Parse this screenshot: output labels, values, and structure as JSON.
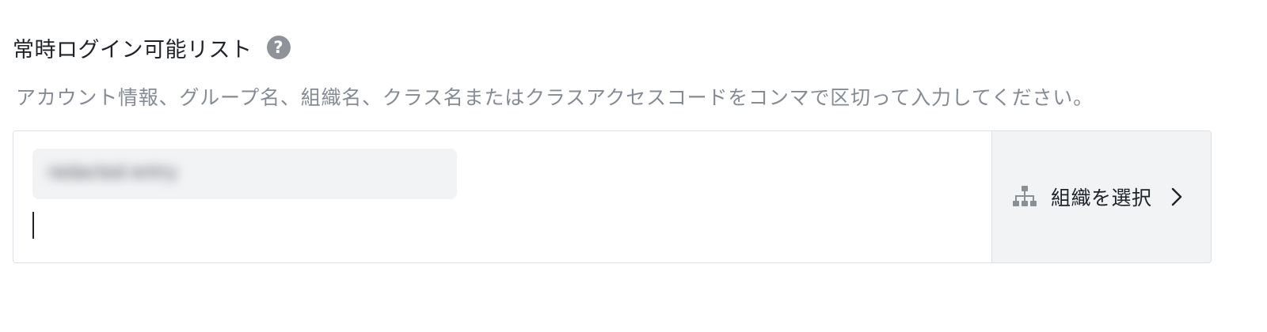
{
  "section": {
    "title": "常時ログイン可能リスト",
    "help_glyph": "?",
    "description": "アカウント情報、グループ名、組織名、クラス名またはクラスアクセスコードをコンマで区切って入力してください。"
  },
  "input": {
    "tag_text": "redacted entry",
    "value": ""
  },
  "picker": {
    "label": "組織を選択",
    "icon": "org-chart-icon",
    "arrow_icon": "chevron-right-icon"
  },
  "colors": {
    "text_primary": "#1f2329",
    "text_secondary": "#858b94",
    "help_bg": "#8f9399",
    "border": "#dcdfe3",
    "picker_bg": "#f2f3f5"
  }
}
